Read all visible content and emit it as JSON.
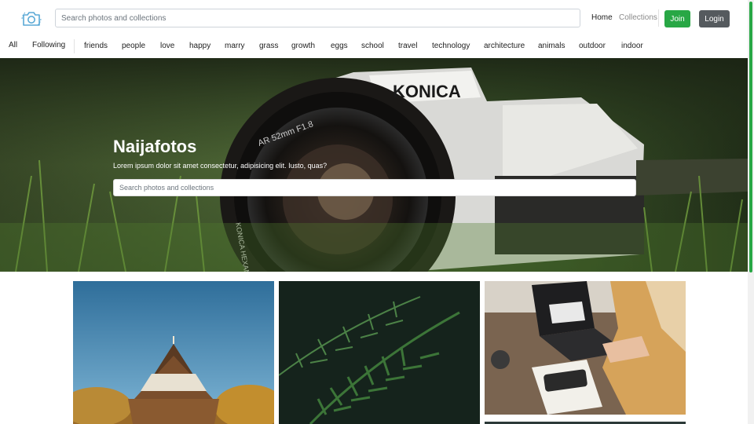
{
  "header": {
    "logo_icon": "camera-icon",
    "search": {
      "placeholder": "Search photos and collections"
    },
    "nav": {
      "home": "Home",
      "collections": "Collections"
    },
    "join_label": "Join",
    "login_label": "Login"
  },
  "categories": [
    "All",
    "Following",
    "friends",
    "people",
    "love",
    "happy",
    "marry",
    "grass",
    "growth",
    "eggs",
    "school",
    "travel",
    "technology",
    "architecture",
    "animals",
    "outdoor",
    "indoor"
  ],
  "hero": {
    "title": "Naijafotos",
    "subtitle": "Lorem ipsum dolor sit amet consectetur, adipisicing elit. Iusto, quas?",
    "search_placeholder": "Search photos and collections",
    "camera_brand": "KONICA",
    "lens_text": "AR 52mm F1.8",
    "lens_side_text": "KONICA HEXANON"
  },
  "colors": {
    "accent": "#28a745",
    "login_button": "#555a5e"
  }
}
